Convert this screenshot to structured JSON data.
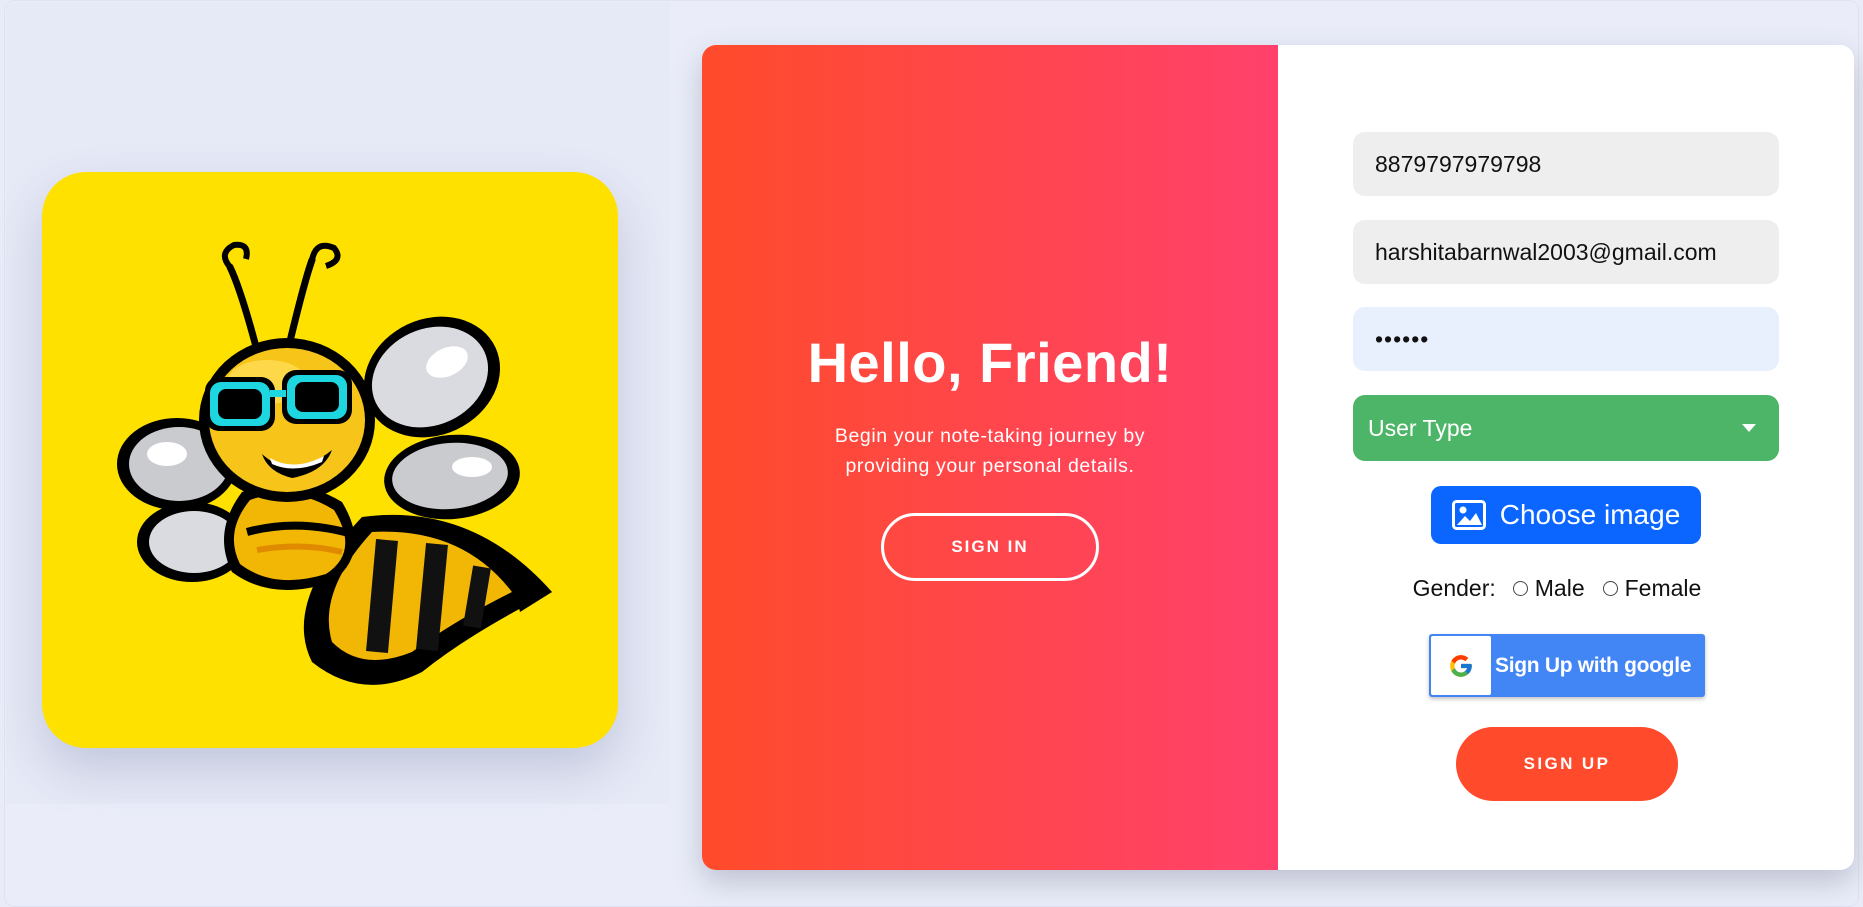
{
  "overlay": {
    "title": "Hello, Friend!",
    "text": "Begin your note-taking journey by providing your personal details.",
    "signin_label": "SIGN IN"
  },
  "form": {
    "phone_value": "8879797979798",
    "email_value": "harshitabarnwal2003@gmail.com",
    "password_value": "••••••",
    "user_type_label": "User Type",
    "choose_image_label": "Choose image",
    "gender_label": "Gender:",
    "gender_options": [
      "Male",
      "Female"
    ],
    "google_label": "Sign Up with google",
    "signup_label": "SIGN UP"
  },
  "icons": {
    "logo": "bee-mascot-logo",
    "image": "image-icon",
    "google": "google-g-icon",
    "dropdown": "caret-down-icon"
  },
  "colors": {
    "overlay_start": "#ff4b2b",
    "overlay_end": "#ff416c",
    "logo_bg": "#ffe100",
    "user_type_bg": "#4cb568",
    "choose_image_bg": "#0a66ff",
    "google_bg": "#4285f4",
    "signup_bg": "#ff4b2b"
  }
}
